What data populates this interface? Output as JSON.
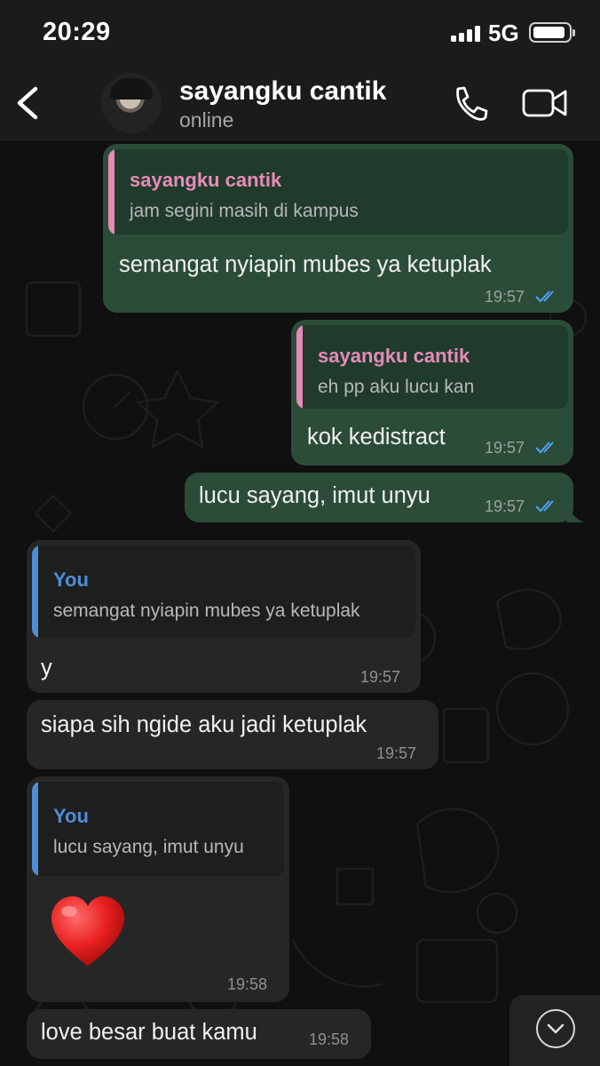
{
  "status_bar": {
    "time": "20:29",
    "network": "5G"
  },
  "header": {
    "contact_name": "sayangku cantik",
    "contact_status": "online"
  },
  "colors": {
    "outgoing_bubble": "#2b4c39",
    "incoming_bubble": "#262626",
    "quote_contact": "#e68bb8",
    "quote_you": "#4d8ed4",
    "read_ticks": "#4fa3f7"
  },
  "icons": {
    "back": "chevron-left-icon",
    "call": "phone-icon",
    "video": "video-camera-icon",
    "ticks": "double-check-icon",
    "scroll": "chevron-down-icon"
  },
  "messages": [
    {
      "direction": "outgoing",
      "quote_author": "sayangku cantik",
      "quote_text": "jam segini masih di kampus",
      "text": "semangat nyiapin mubes ya ketuplak",
      "time": "19:57",
      "status": "read"
    },
    {
      "direction": "outgoing",
      "quote_author": "sayangku cantik",
      "quote_text": "eh pp aku lucu kan",
      "text": "kok kedistract",
      "time": "19:57",
      "status": "read"
    },
    {
      "direction": "outgoing",
      "text": "lucu sayang, imut unyu",
      "time": "19:57",
      "status": "read"
    },
    {
      "direction": "incoming",
      "quote_author": "You",
      "quote_text": "semangat nyiapin mubes ya ketuplak",
      "text": "y",
      "time": "19:57"
    },
    {
      "direction": "incoming",
      "text": "siapa sih ngide aku jadi ketuplak",
      "time": "19:57"
    },
    {
      "direction": "incoming",
      "quote_author": "You",
      "quote_text": "lucu sayang, imut unyu",
      "text": "❤️",
      "time": "19:58"
    },
    {
      "direction": "incoming",
      "text": "love besar buat kamu",
      "time": "19:58"
    }
  ]
}
